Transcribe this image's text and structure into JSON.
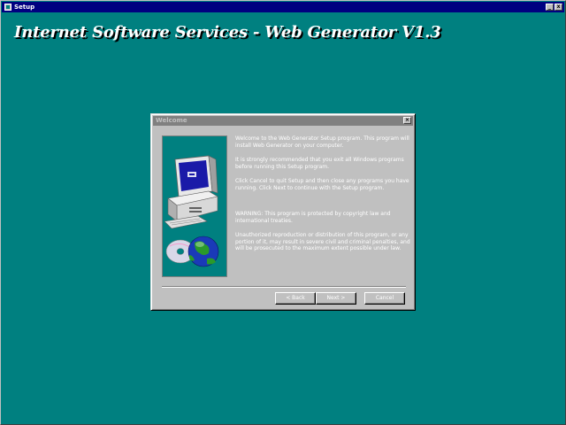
{
  "window": {
    "title": "Setup",
    "minimize_glyph": "_",
    "close_glyph": "x"
  },
  "product_title": "Internet Software Services - Web Generator V1.3",
  "dialog": {
    "title": "Welcome",
    "close_glyph": "×",
    "paragraphs": [
      "Welcome to the Web Generator Setup program. This program will install Web Generator on your computer.",
      "It is strongly recommended that you exit all Windows programs before running this Setup program.",
      "Click Cancel to quit Setup and then close any programs you have running. Click Next to continue with the Setup program.",
      "WARNING: This program is protected by copyright law and international treaties.",
      "Unauthorized reproduction or distribution of this program, or any portion of it, may result in severe civil and criminal penalties, and will be prosecuted to the maximum extent possible under law."
    ],
    "buttons": {
      "back": "< Back",
      "next": "Next >",
      "cancel": "Cancel"
    }
  },
  "icons": {
    "app": "setup-app-icon",
    "art": "computer-and-globe-illustration"
  },
  "colors": {
    "desktop": "#008080",
    "active_title": "#000080",
    "inactive_title": "#808080",
    "face": "#c0c0c0"
  }
}
